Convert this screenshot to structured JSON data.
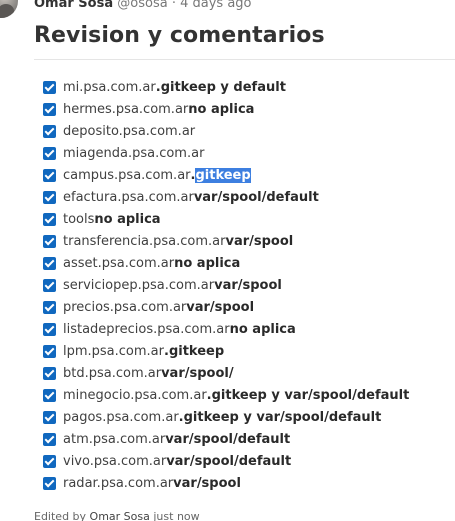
{
  "comment": {
    "author": "Omar Sosa",
    "handle": "@ososa",
    "separator": " · ",
    "time": "4 days ago",
    "title": "Revision y comentarios"
  },
  "tasks": [
    {
      "host": "mi.psa.com.ar",
      "note": ".gitkeep y default",
      "checked": true
    },
    {
      "host": "hermes.psa.com.ar",
      "note": "no aplica",
      "checked": true
    },
    {
      "host": "deposito.psa.com.ar",
      "note": "",
      "checked": true
    },
    {
      "host": "miagenda.psa.com.ar",
      "note": "",
      "checked": true
    },
    {
      "host": "campus.psa.com.ar",
      "note_prefix": ".",
      "note_selected": "gitkeep",
      "checked": true
    },
    {
      "host": "efactura.psa.com.ar",
      "note": "var/spool/default",
      "checked": true
    },
    {
      "host": "tools",
      "note": "no aplica",
      "checked": true
    },
    {
      "host": "transferencia.psa.com.ar",
      "note": "var/spool",
      "checked": true
    },
    {
      "host": "asset.psa.com.ar",
      "note": "no aplica",
      "checked": true
    },
    {
      "host": "serviciopep.psa.com.ar",
      "note": "var/spool",
      "checked": true
    },
    {
      "host": "precios.psa.com.ar",
      "note": "var/spool",
      "checked": true
    },
    {
      "host": "listadeprecios.psa.com.ar",
      "note": "no aplica",
      "checked": true
    },
    {
      "host": "lpm.psa.com.ar",
      "note": ".gitkeep",
      "checked": true
    },
    {
      "host": "btd.psa.com.ar",
      "note": "var/spool/",
      "checked": true
    },
    {
      "host": "minegocio.psa.com.ar",
      "note": ".gitkeep y var/spool/default",
      "checked": true
    },
    {
      "host": "pagos.psa.com.ar",
      "note": ".gitkeep y var/spool/default",
      "checked": true
    },
    {
      "host": "atm.psa.com.ar",
      "note": "var/spool/default",
      "checked": true
    },
    {
      "host": "vivo.psa.com.ar",
      "note": "var/spool/default",
      "checked": true
    },
    {
      "host": "radar.psa.com.ar",
      "note": "var/spool",
      "checked": true
    }
  ],
  "edited": {
    "prefix": "Edited by ",
    "by": "Omar Sosa",
    "suffix": " just now"
  }
}
